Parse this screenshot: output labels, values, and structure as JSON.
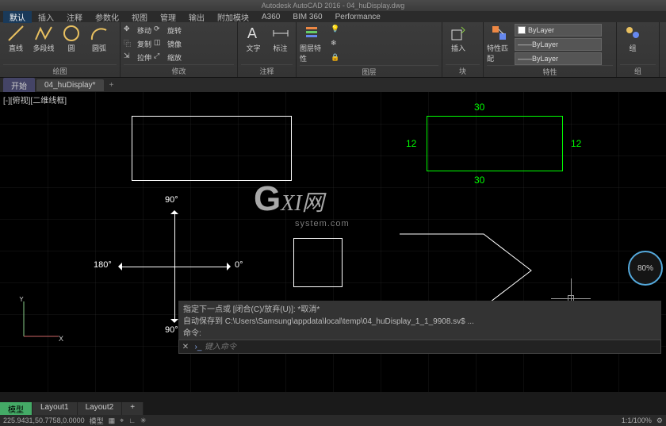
{
  "title": "Autodesk AutoCAD 2016 - 04_huDisplay.dwg",
  "menu": [
    "默认",
    "插入",
    "注释",
    "参数化",
    "视图",
    "管理",
    "输出",
    "附加模块",
    "A360",
    "BIM 360",
    "Performance"
  ],
  "menu_active": 0,
  "ribbon": {
    "panels": [
      {
        "label": "绘图",
        "big": [
          {
            "icon": "line",
            "label": "直线"
          },
          {
            "icon": "pline",
            "label": "多段线"
          },
          {
            "icon": "circle",
            "label": "圆"
          },
          {
            "icon": "arc",
            "label": "圆弧"
          }
        ]
      },
      {
        "label": "修改",
        "rows": [
          [
            "移动",
            "旋转"
          ],
          [
            "复制",
            "镜像"
          ],
          [
            "拉伸",
            "缩放"
          ]
        ]
      },
      {
        "label": "注释",
        "big": [
          {
            "icon": "text",
            "label": "文字"
          },
          {
            "icon": "dim",
            "label": "标注"
          }
        ]
      },
      {
        "label": "图层",
        "big": [
          {
            "icon": "layers",
            "label": "图层特性"
          }
        ]
      },
      {
        "label": "块",
        "big": [
          {
            "icon": "insert",
            "label": "插入"
          }
        ]
      },
      {
        "label": "特性",
        "big": [
          {
            "icon": "props",
            "label": "特性匹配"
          }
        ],
        "layer_dd": "ByLayer"
      },
      {
        "label": "组",
        "big": [
          {
            "icon": "group",
            "label": "组"
          }
        ]
      }
    ]
  },
  "file_tabs": {
    "start": "开始",
    "active": "04_huDisplay*"
  },
  "view_label": "[-][俯视][二维线框]",
  "dims": {
    "top": "30",
    "bottom": "30",
    "left": "12",
    "right": "12"
  },
  "compass": {
    "n": "90°",
    "s": "90°",
    "e": "0°",
    "w": "180°"
  },
  "polar": "80%",
  "watermark": {
    "main": "GXI网",
    "sub": "system.com"
  },
  "cmd": {
    "hist1": "指定下一点或 [闭合(C)/放弃(U)]: *取消*",
    "hist2": "自动保存到 C:\\Users\\Samsung\\appdata\\local\\temp\\04_huDisplay_1_1_9908.sv$ ...",
    "hist3": "命令:",
    "placeholder": "键入命令"
  },
  "layout_tabs": [
    "模型",
    "Layout1",
    "Layout2"
  ],
  "status": {
    "coords": "225.9431,50.7758,0.0000",
    "space": "模型",
    "zoom": "1:1/100%"
  }
}
